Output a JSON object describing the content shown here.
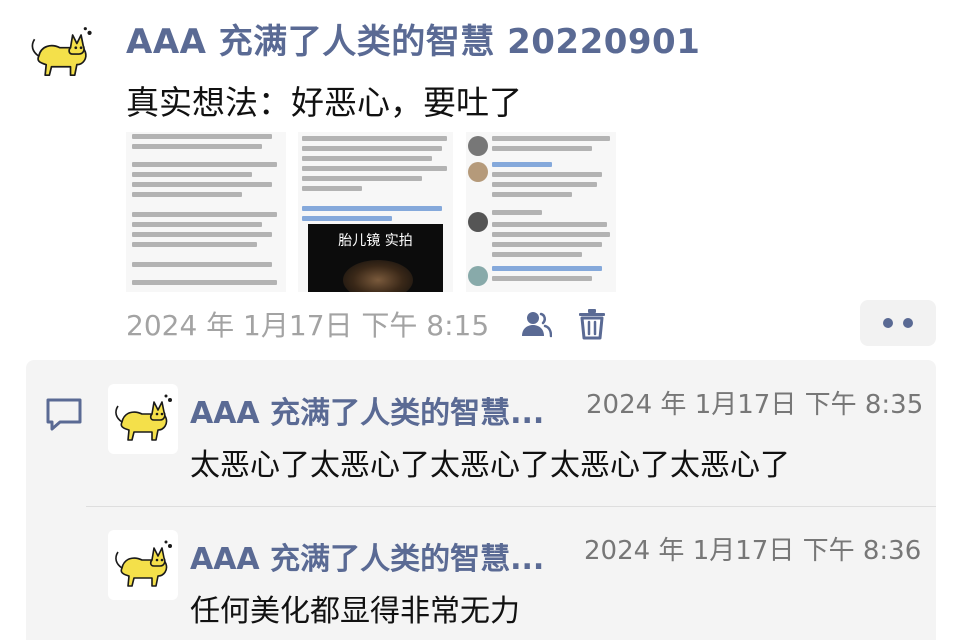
{
  "post": {
    "author": "AAA 充满了人类的智慧 20220901",
    "text": "真实想法：好恶心，要吐了",
    "timestamp": "2024 年 1月17日 下午 8:15",
    "images": {
      "count": 3,
      "video_caption": "胎儿镜 实拍"
    },
    "actions": {
      "people_icon": "person-icon",
      "delete_icon": "trash-icon",
      "more_icon": "more-dots-icon"
    }
  },
  "comments": {
    "icon": "comment-bubble-icon",
    "items": [
      {
        "author": "AAA 充满了人类的智慧...",
        "time": "2024 年 1月17日 下午 8:35",
        "text": "太恶心了太恶心了太恶心了太恶心了太恶心了"
      },
      {
        "author": "AAA 充满了人类的智慧...",
        "time": "2024 年 1月17日 下午 8:36",
        "text": "任何美化都显得非常无力"
      }
    ]
  },
  "colors": {
    "author": "#5a6a94",
    "meta": "#a3a3a3",
    "panel_bg": "#f4f4f4",
    "avatar_cat": "#f4e04a"
  }
}
